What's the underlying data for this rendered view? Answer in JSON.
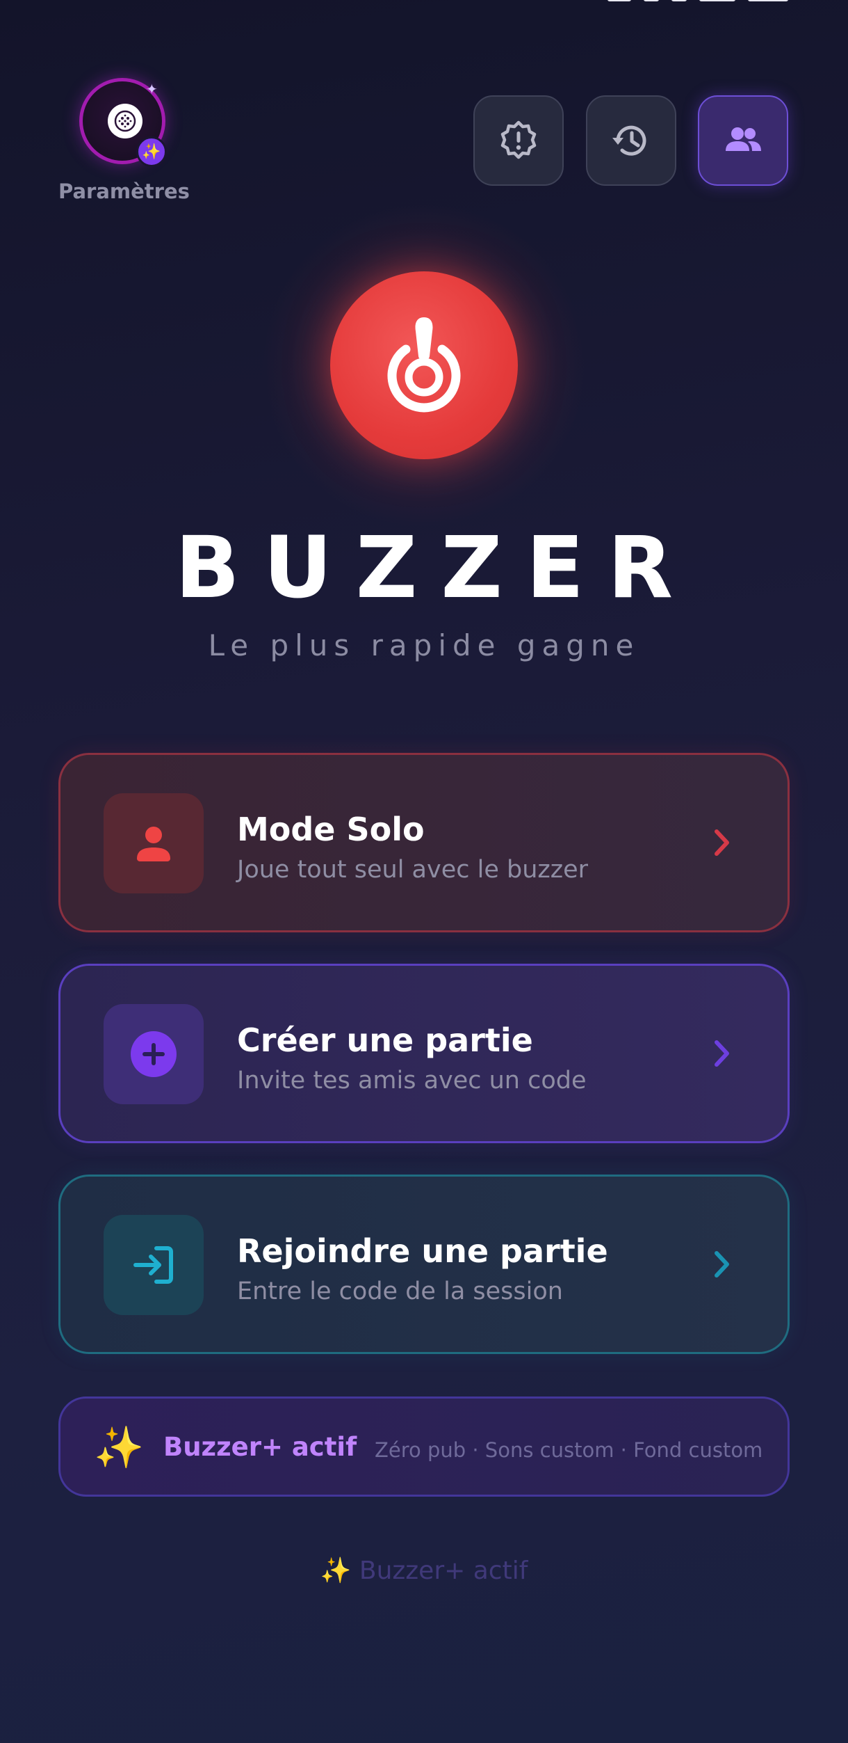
{
  "settings": {
    "label": "Paramètres",
    "badge_icon": "sparkles-icon"
  },
  "top_buttons": [
    {
      "name": "alert-badge-icon",
      "active": false
    },
    {
      "name": "history-icon",
      "active": false
    },
    {
      "name": "players-icon",
      "active": true
    }
  ],
  "hero": {
    "icon": "buzzer-icon",
    "title": "BUZZER",
    "subtitle": "Le plus rapide gagne"
  },
  "cards": [
    {
      "title": "Mode Solo",
      "subtitle": "Joue tout seul avec le buzzer",
      "icon": "person-icon",
      "accent": "#e53e3e"
    },
    {
      "title": "Créer une partie",
      "subtitle": "Invite tes amis avec un code",
      "icon": "plus-circle-icon",
      "accent": "#7c3aed"
    },
    {
      "title": "Rejoindre une partie",
      "subtitle": "Entre le code de la session",
      "icon": "login-arrow-icon",
      "accent": "#1ba3c6"
    }
  ],
  "premium": {
    "icon": "✨",
    "title": "Buzzer+ actif",
    "features": "Zéro pub · Sons custom · Fond custom"
  },
  "footer": {
    "icon": "✨",
    "text": "Buzzer+ actif"
  },
  "colors": {
    "background": "#17182f",
    "solo_accent": "#e53e3e",
    "create_accent": "#7c3aed",
    "join_accent": "#1ba3c6",
    "premium_text": "#c084fc"
  }
}
